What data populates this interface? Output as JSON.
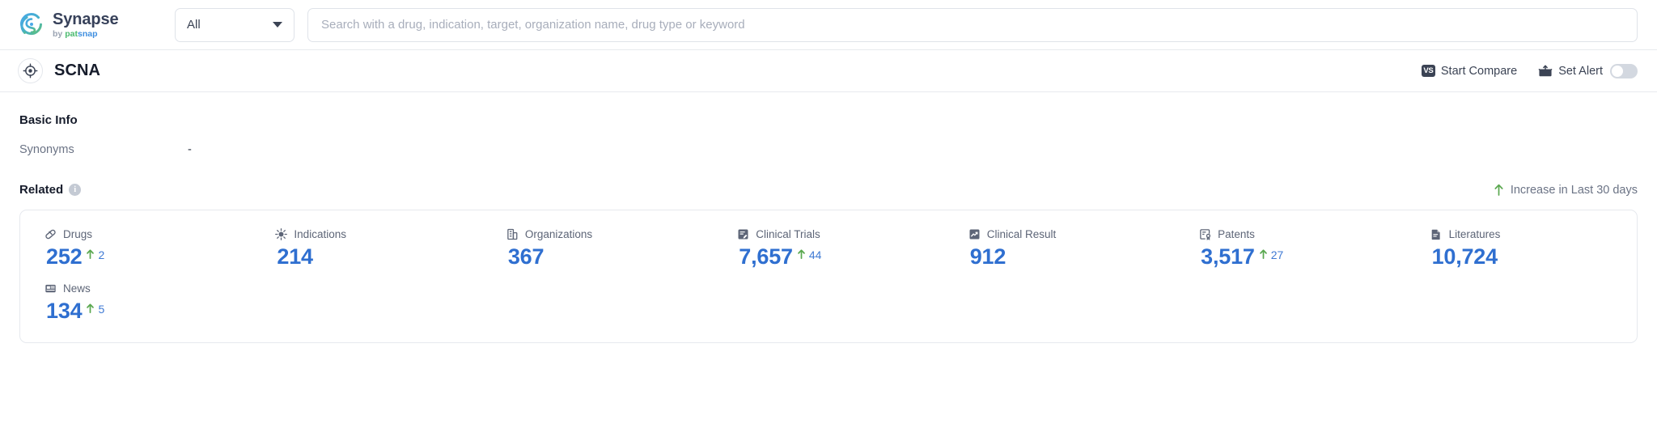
{
  "brand": {
    "name": "Synapse",
    "by": "by",
    "patsnap_p": "pat",
    "patsnap_s": "snap",
    "logo_icon": "synapse-swirl-logo"
  },
  "search": {
    "scope_value": "All",
    "scope_icon": "chevron-down-icon",
    "placeholder": "Search with a drug, indication, target, organization name, drug type or keyword",
    "value": ""
  },
  "entity": {
    "icon": "target-crosshair-icon",
    "title": "SCNA"
  },
  "actions": {
    "compare_label": "Start Compare",
    "compare_icon": "vs-badge-icon",
    "compare_badge_text": "VS",
    "alert_label": "Set Alert",
    "alert_icon": "envelope-alert-icon",
    "alert_toggle_state": "off"
  },
  "basic_info": {
    "heading": "Basic Info",
    "rows": [
      {
        "label": "Synonyms",
        "value": "-"
      }
    ]
  },
  "related": {
    "heading": "Related",
    "info_icon": "info-icon",
    "info_icon_glyph": "i",
    "legend_icon": "arrow-up-icon",
    "legend_label": "Increase in Last 30 days",
    "accent_color": "#2f6fd0",
    "increase_color": "#5aa84f",
    "metrics": [
      {
        "label": "Drugs",
        "icon": "pill-icon",
        "value": "252",
        "delta": "2",
        "has_delta": true
      },
      {
        "label": "Indications",
        "icon": "virus-icon",
        "value": "214",
        "delta": "",
        "has_delta": false
      },
      {
        "label": "Organizations",
        "icon": "building-icon",
        "value": "367",
        "delta": "",
        "has_delta": false
      },
      {
        "label": "Clinical Trials",
        "icon": "clinical-trial-icon",
        "value": "7,657",
        "delta": "44",
        "has_delta": true
      },
      {
        "label": "Clinical Result",
        "icon": "clinical-result-icon",
        "value": "912",
        "delta": "",
        "has_delta": false
      },
      {
        "label": "Patents",
        "icon": "patent-icon",
        "value": "3,517",
        "delta": "27",
        "has_delta": true
      },
      {
        "label": "Literatures",
        "icon": "literature-icon",
        "value": "10,724",
        "delta": "",
        "has_delta": false
      },
      {
        "label": "News",
        "icon": "news-icon",
        "value": "134",
        "delta": "5",
        "has_delta": true
      }
    ]
  }
}
